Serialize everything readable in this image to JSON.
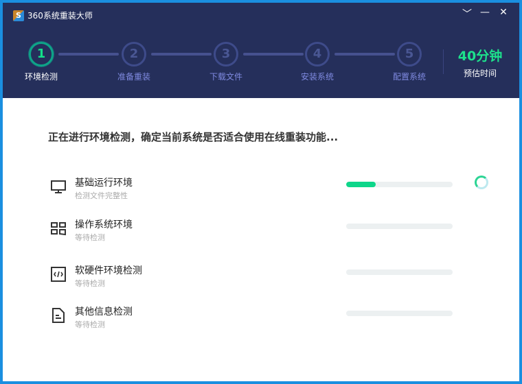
{
  "app": {
    "title": "360系统重装大师",
    "logo_text": "S"
  },
  "controls": {
    "dropdown": "﹀",
    "minimize": "—",
    "close": "✕"
  },
  "steps": [
    {
      "num": "1",
      "label": "环境检测"
    },
    {
      "num": "2",
      "label": "准备重装"
    },
    {
      "num": "3",
      "label": "下载文件"
    },
    {
      "num": "4",
      "label": "安装系统"
    },
    {
      "num": "5",
      "label": "配置系统"
    }
  ],
  "estimate": {
    "value": "40分钟",
    "label": "预估时间"
  },
  "heading": "正在进行环境检测，确定当前系统是否适合使用在线重装功能...",
  "checks": [
    {
      "name": "基础运行环境",
      "status": "检测文件完整性",
      "progress": 28,
      "icon": "monitor-icon"
    },
    {
      "name": "操作系统环境",
      "status": "等待检测",
      "progress": 0,
      "icon": "windows-icon"
    },
    {
      "name": "软硬件环境检测",
      "status": "等待检测",
      "progress": 0,
      "icon": "code-icon"
    },
    {
      "name": "其他信息检测",
      "status": "等待检测",
      "progress": 0,
      "icon": "document-icon"
    }
  ],
  "colors": {
    "header": "#252f5b",
    "accent": "#0ed68a",
    "border": "#1a8fe0"
  }
}
